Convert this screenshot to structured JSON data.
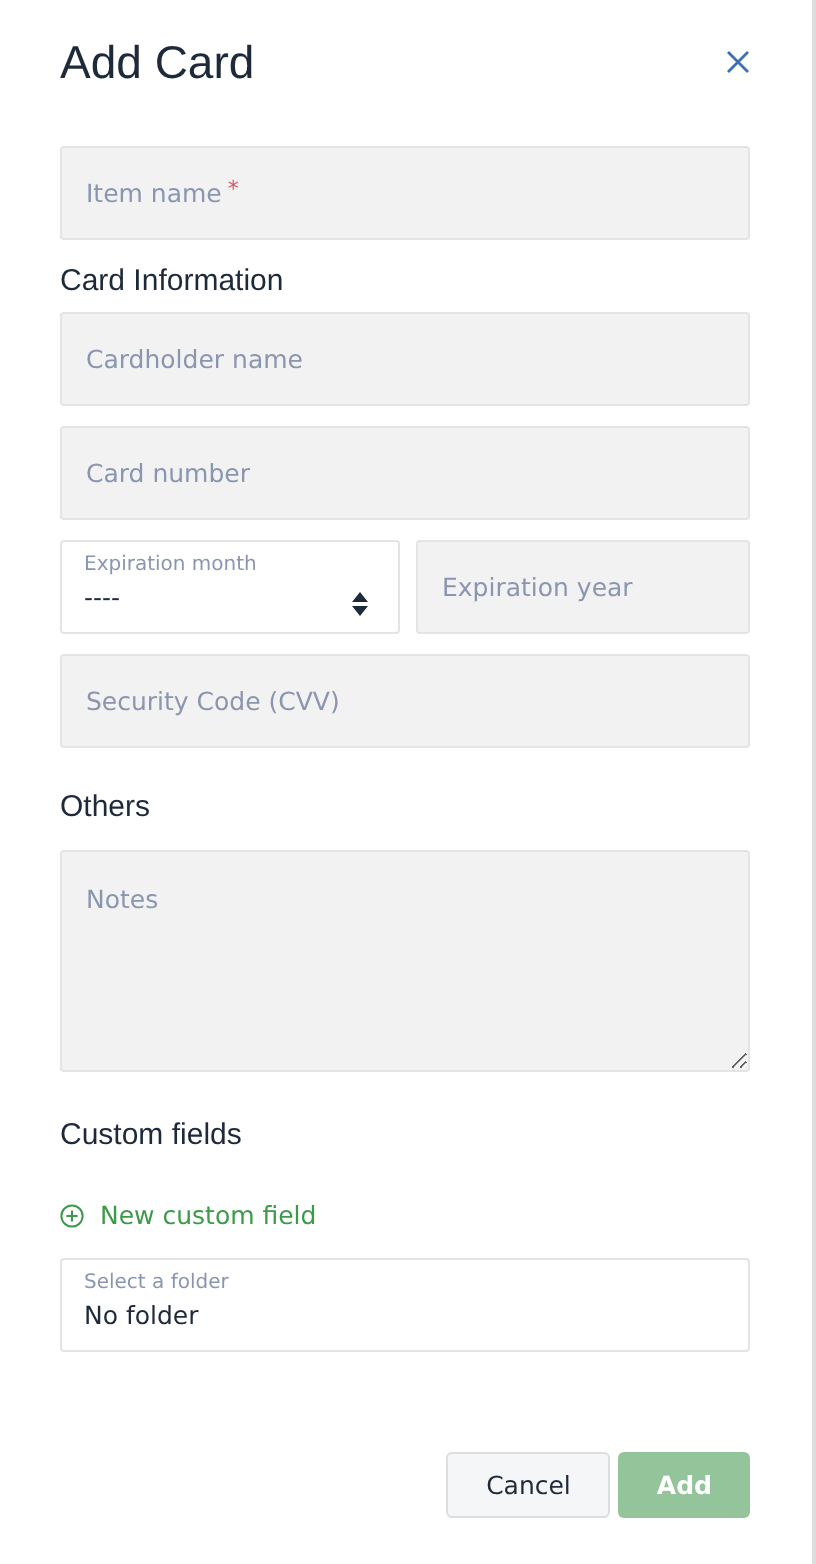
{
  "title": "Add Card",
  "item_name": {
    "placeholder": "Item name",
    "required_mark": "*"
  },
  "card_section": "Card Information",
  "cardholder": {
    "placeholder": "Cardholder name"
  },
  "card_number": {
    "placeholder": "Card number"
  },
  "expiration_month": {
    "label": "Expiration month",
    "value": "----"
  },
  "expiration_year": {
    "placeholder": "Expiration year"
  },
  "security_code": {
    "placeholder": "Security Code (CVV)"
  },
  "others_section": "Others",
  "notes": {
    "placeholder": "Notes"
  },
  "custom_section": "Custom fields",
  "new_custom_field": "New custom field",
  "folder": {
    "label": "Select a folder",
    "value": "No folder"
  },
  "buttons": [
    {
      "label": "Cancel",
      "kind": "secondary",
      "disabled": false
    },
    {
      "label": "Add",
      "kind": "primary",
      "disabled": true
    }
  ]
}
